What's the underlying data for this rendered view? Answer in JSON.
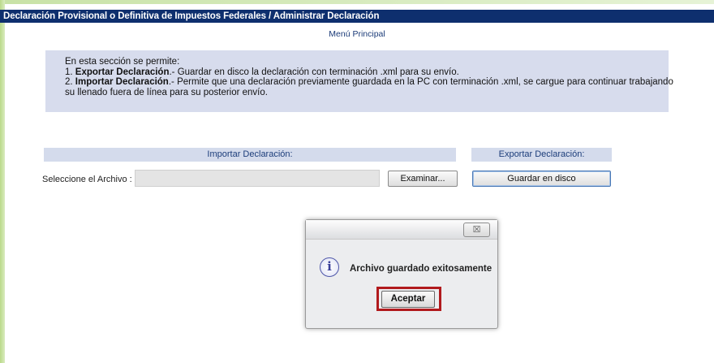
{
  "window": {
    "title": "Declaración Provisional o Definitiva de Impuestos Federales / Administrar Declaración",
    "subtitle": "Menú Principal"
  },
  "info": {
    "intro": "En esta sección se permite:",
    "item1_prefix": "1. ",
    "item1_bold": "Exportar Declaración",
    "item1_text": ".- Guardar en disco la declaración con terminación .xml para su envío.",
    "item2_prefix": "2. ",
    "item2_bold": "Importar Declaración",
    "item2_text": ".- Permite que una declaración previamente guardada en la PC con terminación .xml, se cargue para continuar trabajando",
    "item2_cont": "su llenado fuera de línea para su posterior envío."
  },
  "import": {
    "header": "Importar Declaración:",
    "file_label": "Seleccione el Archivo :",
    "file_value": "",
    "browse_label": "Examinar..."
  },
  "export": {
    "header": "Exportar Declaración:",
    "save_label": "Guardar en disco"
  },
  "dialog": {
    "close_glyph": "☒",
    "icon_glyph": "i",
    "message": "Archivo guardado exitosamente",
    "accept_label": "Aceptar"
  },
  "colors": {
    "titlebar": "#0e2f6e",
    "panel": "#d7dced",
    "highlight": "#b11a1d",
    "accent_green": "#b9d98a"
  },
  "icons": {
    "dialog_close": "close-icon",
    "dialog_info": "info-icon"
  }
}
